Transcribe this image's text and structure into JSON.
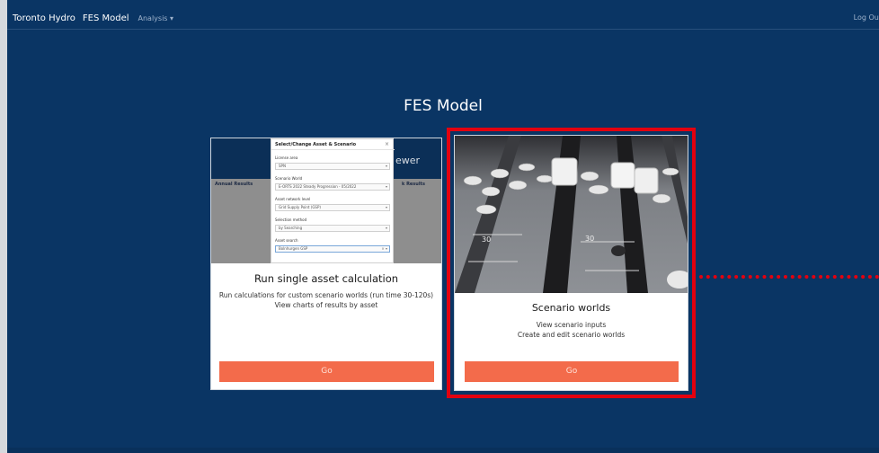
{
  "navbar": {
    "brand": "Toronto Hydro",
    "app_name": "FES Model",
    "analysis_menu": "Analysis",
    "logout": "Log Out"
  },
  "page": {
    "title": "FES Model"
  },
  "cards": [
    {
      "title": "Run single asset calculation",
      "desc_line1": "Run calculations for custom scenario worlds (run time 30-120s)",
      "desc_line2": "View charts of results by asset",
      "button": "Go",
      "preview": {
        "header_text": "ewer",
        "left_heading": "Annual Results",
        "right_heading": "k Results",
        "modal_title": "Select/Change Asset & Scenario",
        "modal_close": "×",
        "fields": [
          {
            "label": "License area",
            "value": "SPN"
          },
          {
            "label": "Scenario World",
            "value": "E-ORTS 2022 Steady Progression - 05/2022"
          },
          {
            "label": "Asset network level",
            "value": "Grid Supply Point (GSP)"
          },
          {
            "label": "Selection method",
            "value": "by Searching"
          },
          {
            "label": "Asset search",
            "value": "Bolnhurgen GSP"
          }
        ]
      }
    },
    {
      "title": "Scenario worlds",
      "desc_line1": "View scenario inputs",
      "desc_line2": "Create and edit scenario worlds",
      "button": "Go",
      "photo_labels": [
        "30",
        "30"
      ]
    }
  ],
  "colors": {
    "background": "#0a3564",
    "button": "#f36b4b",
    "highlight": "#e3000f"
  }
}
